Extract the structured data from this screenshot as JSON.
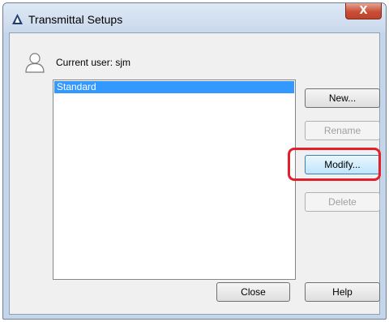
{
  "window": {
    "title": "Transmittal Setups",
    "close_glyph": "X"
  },
  "user": {
    "label": "Current user: sjm",
    "icon": "user-icon"
  },
  "setups": {
    "items": [
      "Standard"
    ],
    "selected": "Standard"
  },
  "buttons": {
    "new": "New...",
    "rename": "Rename",
    "modify": "Modify...",
    "delete": "Delete",
    "close": "Close",
    "help": "Help"
  },
  "colors": {
    "selection": "#3399ff",
    "highlight": "#e3202a",
    "close_button": "#c74f36"
  }
}
